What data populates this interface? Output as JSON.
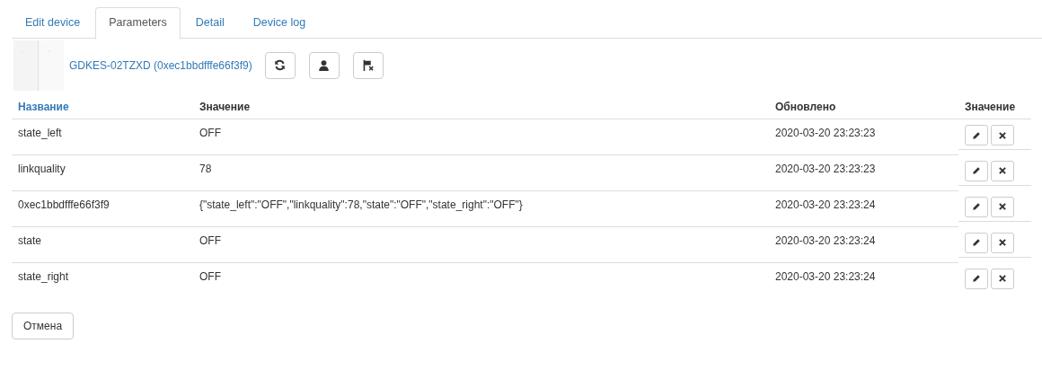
{
  "tabs": [
    {
      "label": "Edit device",
      "selected": false
    },
    {
      "label": "Parameters",
      "selected": true
    },
    {
      "label": "Detail",
      "selected": false
    },
    {
      "label": "Device log",
      "selected": false
    }
  ],
  "device": {
    "link": "GDKES-02TZXD (0xec1bbdfffe66f3f9)",
    "toolbar": [
      {
        "kind": "refresh"
      },
      {
        "kind": "user"
      },
      {
        "kind": "flag-remove"
      }
    ]
  },
  "table": {
    "columns": [
      {
        "label": "Название",
        "sortable": true
      },
      {
        "label": "Значение",
        "sortable": false
      },
      {
        "label": "Обновлено",
        "sortable": false
      },
      {
        "label": "Значение",
        "sortable": false
      }
    ],
    "rows": [
      {
        "name": "state_left",
        "value": "OFF",
        "updated": "2020-03-20 23:23:23"
      },
      {
        "name": "linkquality",
        "value": "78",
        "updated": "2020-03-20 23:23:23"
      },
      {
        "name": "0xec1bbdfffe66f3f9",
        "value": "{\"state_left\":\"OFF\",\"linkquality\":78,\"state\":\"OFF\",\"state_right\":\"OFF\"}",
        "updated": "2020-03-20 23:23:24"
      },
      {
        "name": "state",
        "value": "OFF",
        "updated": "2020-03-20 23:23:24"
      },
      {
        "name": "state_right",
        "value": "OFF",
        "updated": "2020-03-20 23:23:24"
      }
    ]
  },
  "cancel_button": "Отмена"
}
